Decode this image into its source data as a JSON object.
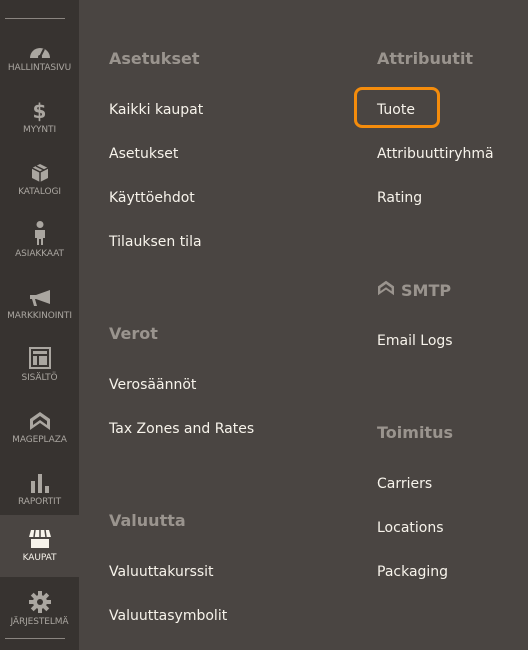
{
  "sidebar": {
    "items": [
      {
        "label": "Hallintasivu",
        "icon": "dashboard-icon"
      },
      {
        "label": "Myynti",
        "icon": "dollar-icon"
      },
      {
        "label": "Katalogi",
        "icon": "box-icon"
      },
      {
        "label": "Asiakkaat",
        "icon": "person-icon"
      },
      {
        "label": "Markkinointi",
        "icon": "megaphone-icon"
      },
      {
        "label": "Sisältö",
        "icon": "layout-icon"
      },
      {
        "label": "Mageplaza",
        "icon": "mageplaza-icon"
      },
      {
        "label": "Raportit",
        "icon": "bar-chart-icon"
      },
      {
        "label": "Kaupat",
        "icon": "store-icon",
        "active": true
      },
      {
        "label": "Järjestelmä",
        "icon": "gear-icon"
      }
    ]
  },
  "menu": {
    "left": [
      {
        "title": "Asetukset",
        "links": [
          "Kaikki kaupat",
          "Asetukset",
          "Käyttöehdot",
          "Tilauksen tila"
        ]
      },
      {
        "title": "Verot",
        "links": [
          "Verosäännöt",
          "Tax Zones and Rates"
        ]
      },
      {
        "title": "Valuutta",
        "links": [
          "Valuuttakurssit",
          "Valuuttasymbolit"
        ]
      }
    ],
    "right": [
      {
        "title": "Attribuutit",
        "links": [
          "Tuote",
          "Attribuuttiryhmä",
          "Rating"
        ]
      },
      {
        "title": "SMTP",
        "icon": "mageplaza-icon",
        "links": [
          "Email Logs"
        ]
      },
      {
        "title": "Toimitus",
        "links": [
          "Carriers",
          "Locations",
          "Packaging"
        ]
      }
    ]
  },
  "highlight": {
    "target": "Tuote",
    "color": "#f48c0c"
  }
}
